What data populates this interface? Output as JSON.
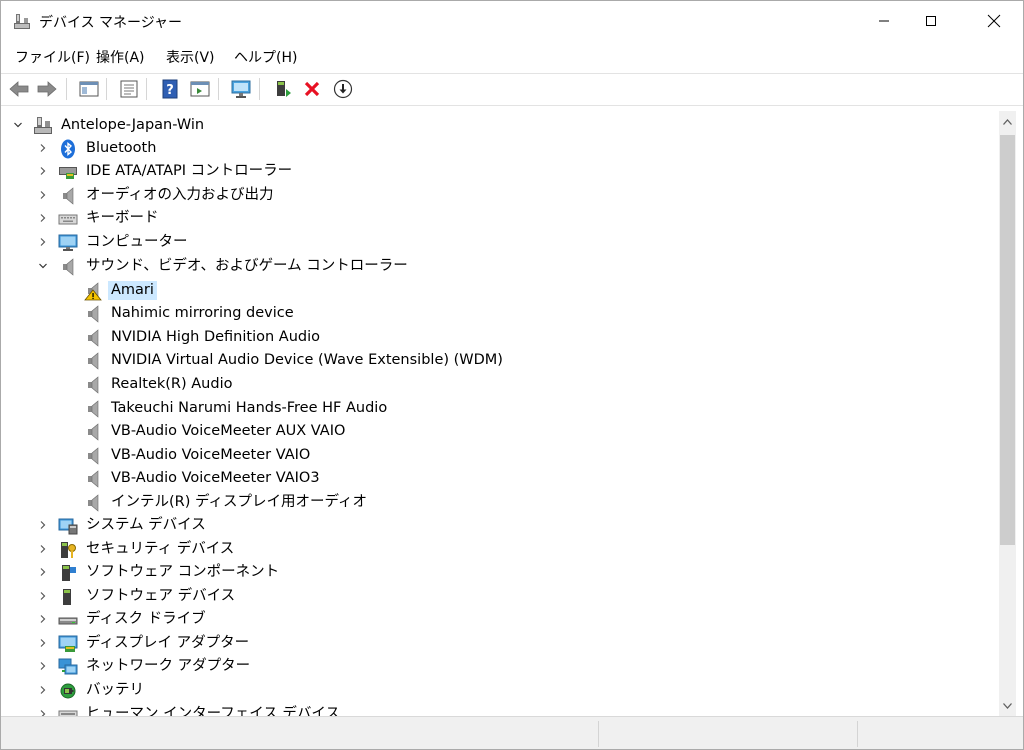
{
  "window": {
    "title": "デバイス マネージャー",
    "icon": "device-manager-icon"
  },
  "menu": [
    "ファイル(F)",
    "操作(A)",
    "表示(V)",
    "ヘルプ(H)"
  ],
  "toolbar_icons": [
    "back-arrow-icon",
    "forward-arrow-icon",
    "show-hide-console-tree-icon",
    "properties-icon",
    "help-icon",
    "action-pane-icon",
    "scan-hardware-changes-icon",
    "update-driver-icon",
    "uninstall-device-icon",
    "download-driver-icon"
  ],
  "tree": {
    "root": "Antelope-Japan-Win",
    "categories": [
      {
        "label": "Bluetooth",
        "icon": "bluetooth-icon",
        "expanded": false
      },
      {
        "label": "IDE ATA/ATAPI コントローラー",
        "icon": "ide-controller-icon",
        "expanded": false
      },
      {
        "label": "オーディオの入力および出力",
        "icon": "speaker-icon",
        "expanded": false
      },
      {
        "label": "キーボード",
        "icon": "keyboard-icon",
        "expanded": false
      },
      {
        "label": "コンピューター",
        "icon": "monitor-icon",
        "expanded": false
      },
      {
        "label": "サウンド、ビデオ、およびゲーム コントローラー",
        "icon": "speaker-icon",
        "expanded": true
      }
    ],
    "sound_devices": [
      {
        "label": "Amari",
        "icon": "warning-speaker-icon",
        "selected": true
      },
      {
        "label": "Nahimic mirroring device",
        "icon": "speaker-icon"
      },
      {
        "label": "NVIDIA High Definition Audio",
        "icon": "speaker-icon"
      },
      {
        "label": "NVIDIA Virtual Audio Device (Wave Extensible) (WDM)",
        "icon": "speaker-icon"
      },
      {
        "label": "Realtek(R) Audio",
        "icon": "speaker-icon"
      },
      {
        "label": "Takeuchi Narumi  Hands-Free HF Audio",
        "icon": "speaker-icon"
      },
      {
        "label": "VB-Audio VoiceMeeter AUX VAIO",
        "icon": "speaker-icon"
      },
      {
        "label": "VB-Audio VoiceMeeter VAIO",
        "icon": "speaker-icon"
      },
      {
        "label": "VB-Audio VoiceMeeter VAIO3",
        "icon": "speaker-icon"
      },
      {
        "label": "インテル(R) ディスプレイ用オーディオ",
        "icon": "speaker-icon"
      }
    ],
    "more_categories": [
      {
        "label": "システム デバイス",
        "icon": "system-devices-icon"
      },
      {
        "label": "セキュリティ デバイス",
        "icon": "security-device-icon"
      },
      {
        "label": "ソフトウェア コンポーネント",
        "icon": "software-component-icon"
      },
      {
        "label": "ソフトウェア デバイス",
        "icon": "software-device-icon"
      },
      {
        "label": "ディスク ドライブ",
        "icon": "disk-drive-icon"
      },
      {
        "label": "ディスプレイ アダプター",
        "icon": "display-adapter-icon"
      },
      {
        "label": "ネットワーク アダプター",
        "icon": "network-adapter-icon"
      },
      {
        "label": "バッテリ",
        "icon": "battery-icon"
      },
      {
        "label": "ヒューマン インターフェイス デバイス",
        "icon": "hid-icon"
      }
    ]
  },
  "colors": {
    "selection": "#cce8ff",
    "uninstall_red": "#e81123",
    "status_bar": "#f0f0f0"
  }
}
